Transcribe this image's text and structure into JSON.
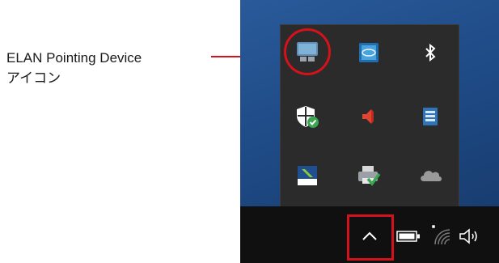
{
  "callout": {
    "line1": "ELAN Pointing Device",
    "line2": "アイコン"
  },
  "tray_icons": [
    {
      "name": "elan-pointing-device-icon"
    },
    {
      "name": "intel-graphics-icon"
    },
    {
      "name": "bluetooth-icon"
    },
    {
      "name": "windows-defender-icon"
    },
    {
      "name": "speaker-icon"
    },
    {
      "name": "storage-device-icon"
    },
    {
      "name": "pen-tool-icon"
    },
    {
      "name": "printer-check-icon"
    },
    {
      "name": "onedrive-cloud-icon"
    }
  ],
  "taskbar": {
    "items": [
      "chevron-up-icon",
      "battery-icon",
      "wifi-icon",
      "volume-icon"
    ]
  },
  "colors": {
    "highlight": "#d5121b",
    "popup_bg": "#2b2b2b",
    "taskbar_bg": "#101010"
  }
}
